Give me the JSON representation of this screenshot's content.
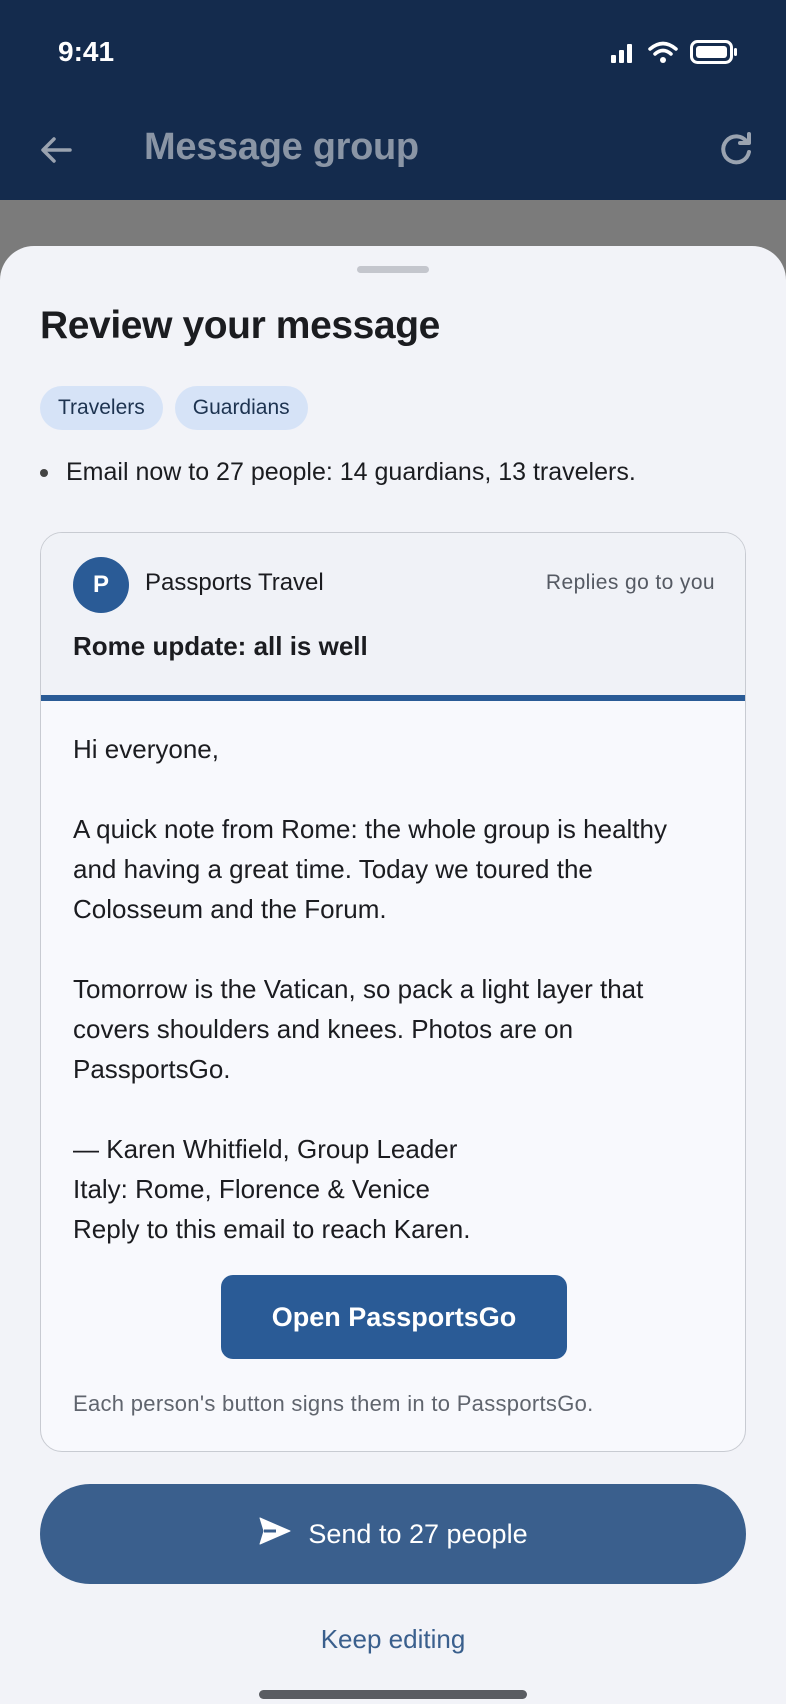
{
  "status_bar": {
    "time": "9:41"
  },
  "app_bar": {
    "title": "Message group"
  },
  "sheet": {
    "title": "Review your message",
    "chips": [
      "Travelers",
      "Guardians"
    ],
    "summary": "Email now to 27 people: 14 guardians, 13 travelers."
  },
  "preview": {
    "avatar_letter": "P",
    "sender": "Passports Travel",
    "reply_note": "Replies go to you",
    "subject": "Rome update: all is well",
    "greeting": "Hi everyone,",
    "paragraph1": "A quick note from Rome: the whole group is healthy and having a great time. Today we toured the Colosseum and the Forum.",
    "paragraph2": "Tomorrow is the Vatican, so pack a light layer that covers shoulders and knees. Photos are on PassportsGo.",
    "signature_line1": "— Karen Whitfield, Group Leader",
    "signature_line2": "Italy: Rome, Florence & Venice",
    "signature_line3": "Reply to this email to reach Karen.",
    "button_label": "Open PassportsGo",
    "footnote": "Each person's button signs them in to PassportsGo."
  },
  "actions": {
    "send_label": "Send to 27 people",
    "keep_editing_label": "Keep editing"
  },
  "colors": {
    "header_bg": "#142b4d",
    "accent": "#2a5b96",
    "send_button": "#3a5f8d",
    "chip_bg": "#d6e3f7"
  }
}
